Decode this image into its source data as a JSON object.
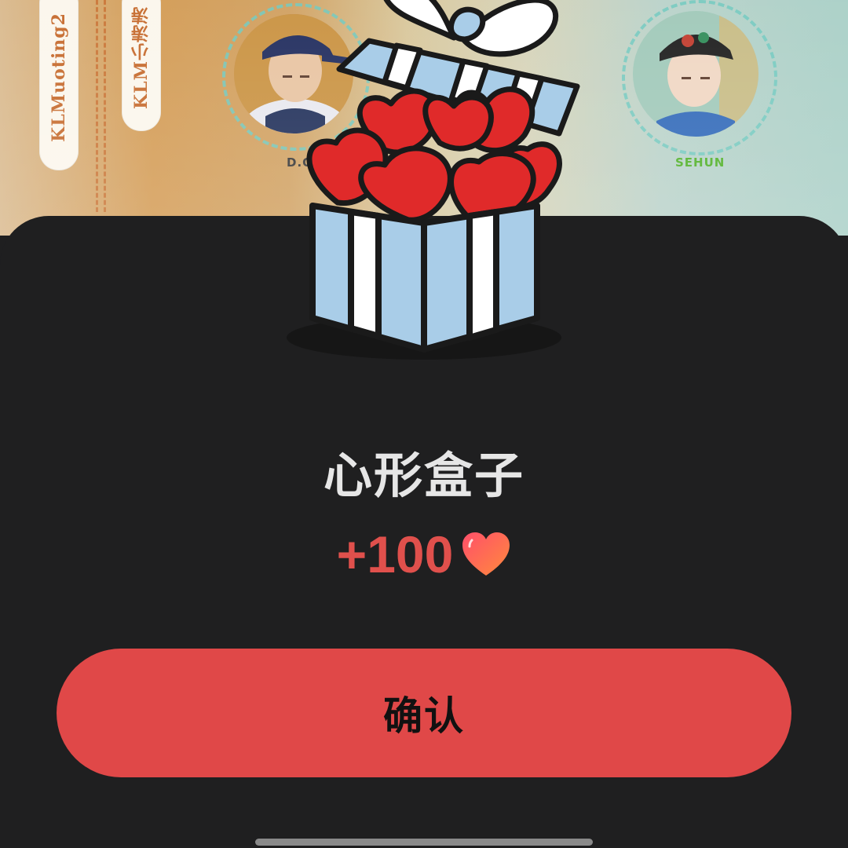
{
  "background": {
    "tags": [
      "KLMuoting2",
      "KLM小涛涛"
    ],
    "avatars": [
      {
        "name": "D.O.",
        "name_color": "#333333"
      },
      {
        "name": "SEHUN",
        "name_color": "#4caf22"
      }
    ]
  },
  "dialog": {
    "icon": "heart-gift-box-icon",
    "title": "心形盒子",
    "reward": "+100",
    "reward_icon": "heart-icon",
    "reward_color": "#e0504c",
    "confirm_label": "确认",
    "confirm_color": "#e04848"
  }
}
